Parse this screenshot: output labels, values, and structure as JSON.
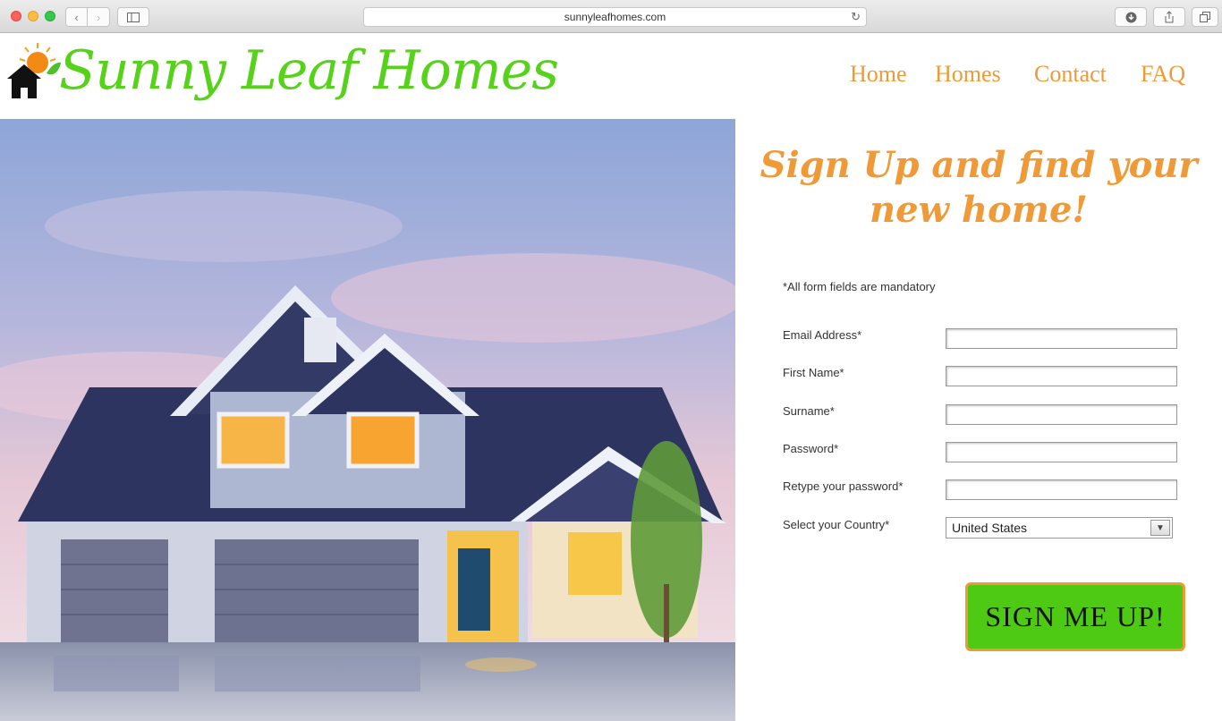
{
  "browser": {
    "url": "sunnyleafhomes.com"
  },
  "site": {
    "brand": "Sunny Leaf Homes",
    "nav": [
      "Home",
      "Homes",
      "Contact",
      "FAQ"
    ]
  },
  "signup": {
    "heading": "Sign Up and find your new home!",
    "note": "*All form fields are mandatory",
    "fields": [
      {
        "label": "Email Address*",
        "value": ""
      },
      {
        "label": "First Name*",
        "value": ""
      },
      {
        "label": "Surname*",
        "value": ""
      },
      {
        "label": "Password*",
        "value": ""
      },
      {
        "label": "Retype your password*",
        "value": ""
      }
    ],
    "country_label": "Select your Country*",
    "country_value": "United States",
    "button": "SIGN ME UP!"
  },
  "colors": {
    "brand_green": "#56d21a",
    "accent_orange": "#ef9a36",
    "button_green": "#4fca14"
  }
}
